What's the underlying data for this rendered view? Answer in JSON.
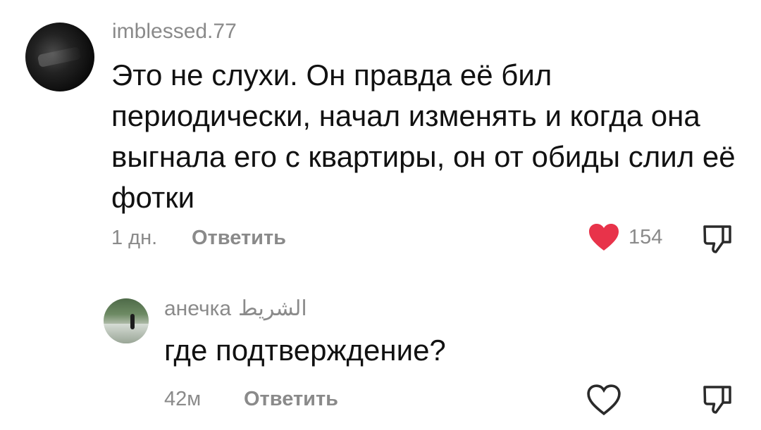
{
  "comments": [
    {
      "username": "imblessed.77",
      "text": "Это не слухи. Он правда её бил периодически, начал изменять и когда она выгнала его с квартиры, он от обиды слил её фотки",
      "time": "1 дн.",
      "reply_label": "Ответить",
      "likes": "154",
      "liked": true,
      "like_color": "#e8334a"
    },
    {
      "username": "анечка",
      "username_extra": "الشريط",
      "text": "где подтверждение?",
      "time": "42м",
      "reply_label": "Ответить",
      "liked": false
    }
  ],
  "icons": {
    "like": "heart-icon",
    "dislike": "thumbs-down-icon"
  }
}
